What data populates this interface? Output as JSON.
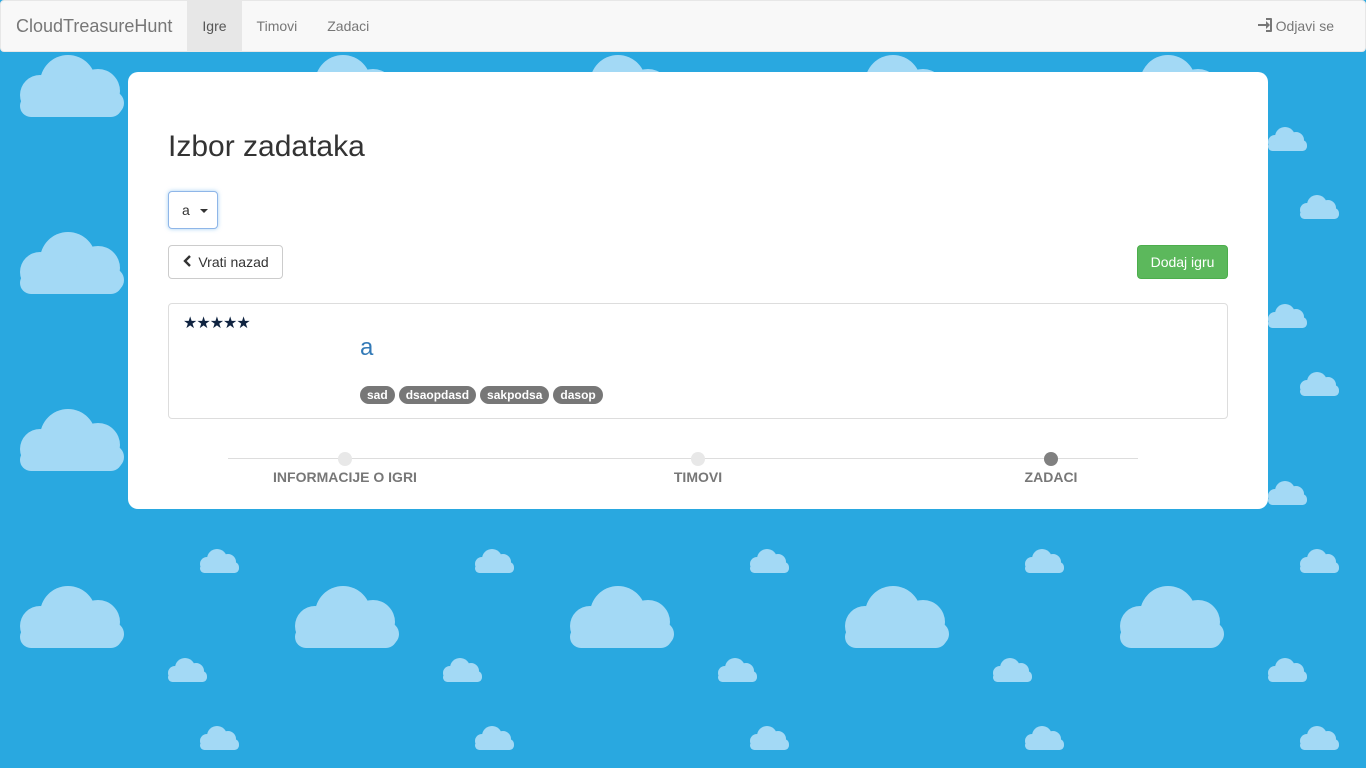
{
  "navbar": {
    "brand": "CloudTreasureHunt",
    "items": [
      {
        "label": "Igre",
        "active": true
      },
      {
        "label": "Timovi",
        "active": false
      },
      {
        "label": "Zadaci",
        "active": false
      }
    ],
    "logout_label": "Odjavi se",
    "logout_icon": "sign-in-icon"
  },
  "page": {
    "title": "Izbor zadataka",
    "select_value": "a",
    "back_label": "Vrati nazad",
    "back_icon": "chevron-left-icon",
    "add_label": "Dodaj igru",
    "add_color": "#5cb85c"
  },
  "card": {
    "stars": "★★★★★",
    "rating": 5,
    "title": "a",
    "tags": [
      "sad",
      "dsaopdasd",
      "sakpodsa",
      "dasop"
    ]
  },
  "steps": {
    "items": [
      {
        "label": "INFORMACIJE O IGRI",
        "done": false
      },
      {
        "label": "TIMOVI",
        "done": false
      },
      {
        "label": "ZADACI",
        "done": true
      }
    ]
  },
  "colors": {
    "background": "#29a8e0",
    "cloud": "#a3d9f5",
    "link": "#337ab7"
  }
}
